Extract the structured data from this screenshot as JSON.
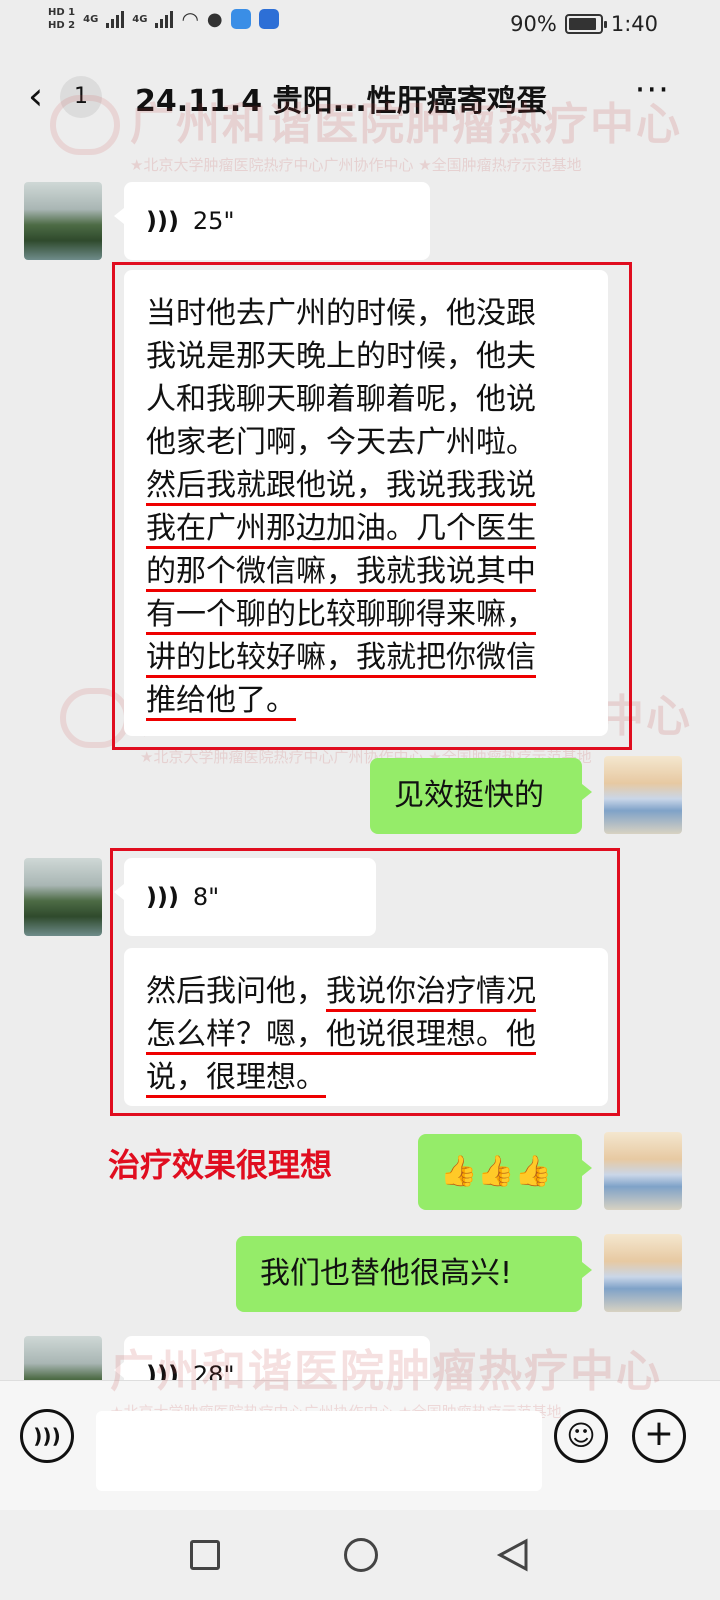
{
  "status_bar": {
    "hd1": "HD 1",
    "hd2": "HD 2",
    "net1": "4G",
    "net2": "4G",
    "battery": "90%",
    "battery_level": 0.9,
    "time": "1:40"
  },
  "header": {
    "unread_count": "1",
    "title": "24.11.4 贵阳...性肝癌寄鸡蛋"
  },
  "watermark": {
    "title": "广州和谐医院肿瘤热疗中心",
    "subtitle": "★北京大学肿瘤医院热疗中心广州协作中心  ★全国肿瘤热疗示范基地"
  },
  "messages": {
    "voice1_duration": "25\"",
    "transcript1_lines": [
      "当时他去广州的时候，他没跟",
      "我说是那天晚上的时候，他夫",
      "人和我聊天聊着聊着呢，他说",
      "他家老门啊，今天去广州啦。",
      "然后我就跟他说，我说我我说",
      "我在广州那边加油。几个医生",
      "的那个微信嘛，我就我说其中",
      "有一个聊的比较聊聊得来嘛，",
      "讲的比较好嘛，我就把你微信",
      "推给他了。"
    ],
    "reply1": "见效挺快的",
    "voice2_duration": "8\"",
    "transcript2_lines": [
      "然后我问他，我说你治疗情况",
      "怎么样？嗯，他说很理想。他",
      "说，很理想。"
    ],
    "annotation": "治疗效果很理想",
    "reply2": "👍👍👍",
    "reply3": "我们也替他很高兴!",
    "voice3_duration": "28\""
  },
  "colors": {
    "highlight_red": "#e00d1f",
    "bubble_green": "#95ec69",
    "chat_bg": "#ededed"
  },
  "icons": [
    "back-chevron-icon",
    "more-icon",
    "voice-wave-icon",
    "voice-mode-icon",
    "emoji-icon",
    "plus-icon",
    "nav-recent-icon",
    "nav-home-icon",
    "nav-back-icon"
  ]
}
